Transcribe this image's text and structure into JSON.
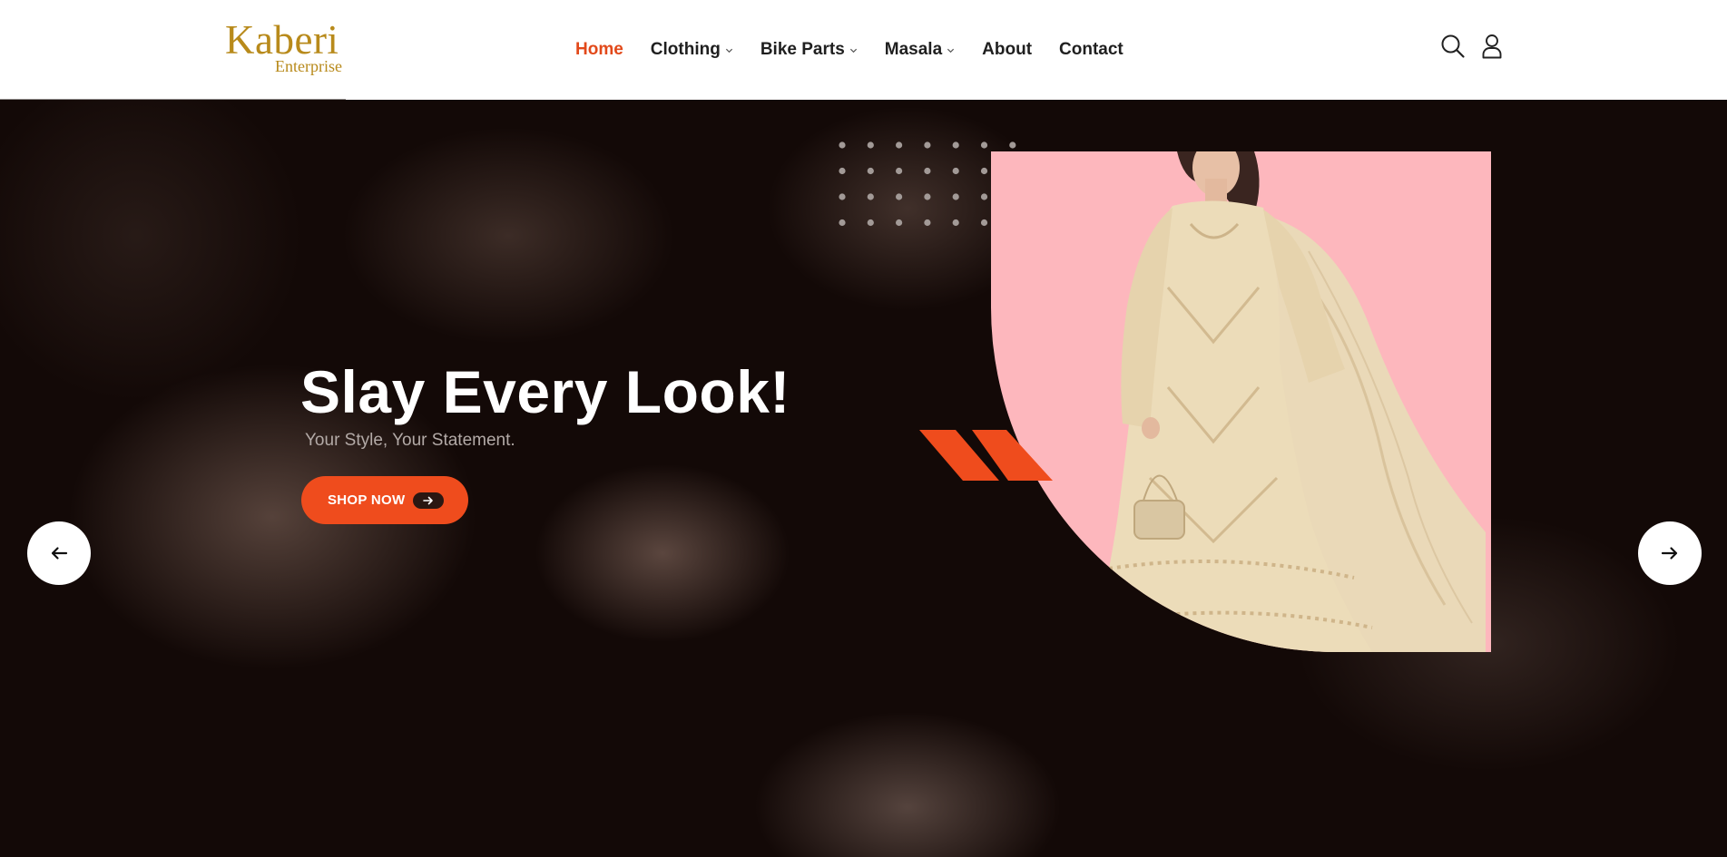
{
  "brand": {
    "name": "Kaberi",
    "tagline": "Enterprise",
    "color": "#b88a1b"
  },
  "nav": {
    "items": [
      {
        "label": "Home",
        "active": true,
        "has_dropdown": false
      },
      {
        "label": "Clothing",
        "active": false,
        "has_dropdown": true
      },
      {
        "label": "Bike Parts",
        "active": false,
        "has_dropdown": true
      },
      {
        "label": "Masala",
        "active": false,
        "has_dropdown": true
      },
      {
        "label": "About",
        "active": false,
        "has_dropdown": false
      },
      {
        "label": "Contact",
        "active": false,
        "has_dropdown": false
      }
    ]
  },
  "header_icons": {
    "search": "search-icon",
    "account": "user-icon"
  },
  "slider": {
    "progress": 0.2
  },
  "hero": {
    "title": "Slay Every Look!",
    "subtitle": "Your Style, Your Statement.",
    "cta_label": "SHOP NOW",
    "cta_icon": "arrow-right-icon",
    "prev_icon": "arrow-left-icon",
    "next_icon": "arrow-right-icon",
    "image_subject": "woman-in-embroidered-dress"
  },
  "colors": {
    "accent": "#ef4c1d",
    "active_nav": "#e2491a",
    "photo_bg": "#fdb7bd",
    "hero_bg": "#130907"
  }
}
